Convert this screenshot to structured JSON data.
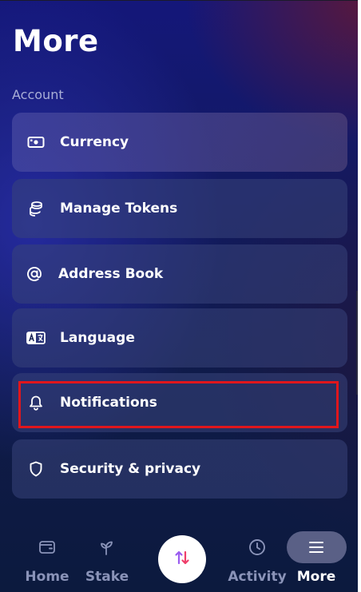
{
  "header": {
    "title": "More"
  },
  "section": {
    "label": "Account"
  },
  "menu": {
    "items": [
      {
        "label": "Currency",
        "icon": "banknote-icon"
      },
      {
        "label": "Manage Tokens",
        "icon": "coins-stack-icon"
      },
      {
        "label": "Address Book",
        "icon": "at-sign-icon"
      },
      {
        "label": "Language",
        "icon": "language-icon"
      },
      {
        "label": "Notifications",
        "icon": "bell-icon"
      },
      {
        "label": "Security & privacy",
        "icon": "shield-icon"
      }
    ]
  },
  "nav": {
    "home": "Home",
    "stake": "Stake",
    "activity": "Activity",
    "more": "More",
    "swap_icon": "swap-arrows-icon"
  },
  "colors": {
    "highlight": "#e0161c",
    "active_pill": "#5a6086",
    "swap_up": "#9a5cf0",
    "swap_down": "#ef3e6a"
  }
}
